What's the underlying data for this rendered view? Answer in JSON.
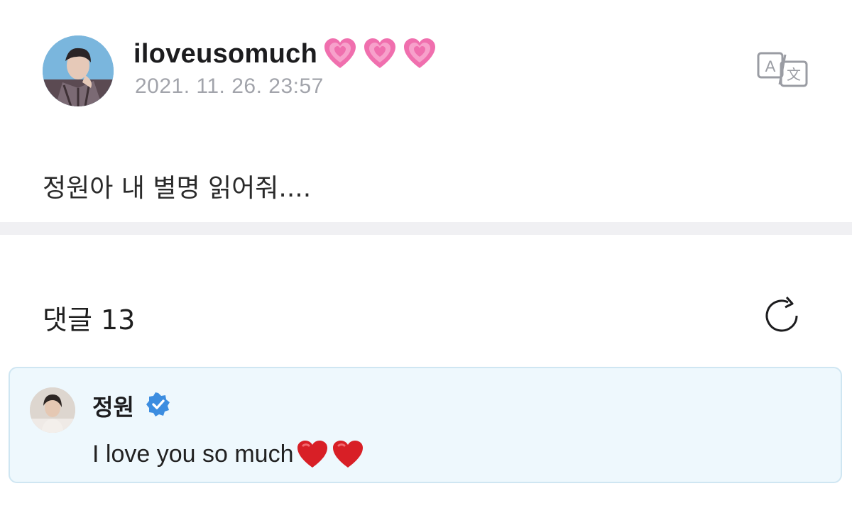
{
  "post": {
    "username": "iloveusomuch",
    "username_emoji": [
      "growing-heart-emoji",
      "growing-heart-emoji",
      "growing-heart-emoji"
    ],
    "date": "2021. 11. 26. 23:57",
    "body": "정원아 내 별명 읽어줘....",
    "translate_icon": "translate-icon"
  },
  "comments": {
    "heading": "댓글 13",
    "refresh_icon": "refresh-icon",
    "items": [
      {
        "author": "정원",
        "verified": true,
        "text": "I love you so much",
        "text_emoji": [
          "red-heart-emoji",
          "red-heart-emoji"
        ]
      }
    ]
  },
  "colors": {
    "date_gray": "#a2a4ab",
    "comment_bg": "#eef8fd",
    "comment_border": "#cfe6f2",
    "verified_blue": "#3c8de0",
    "heart_pink": "#f06fae",
    "heart_red": "#d81f26",
    "divider": "#f0f0f3"
  }
}
